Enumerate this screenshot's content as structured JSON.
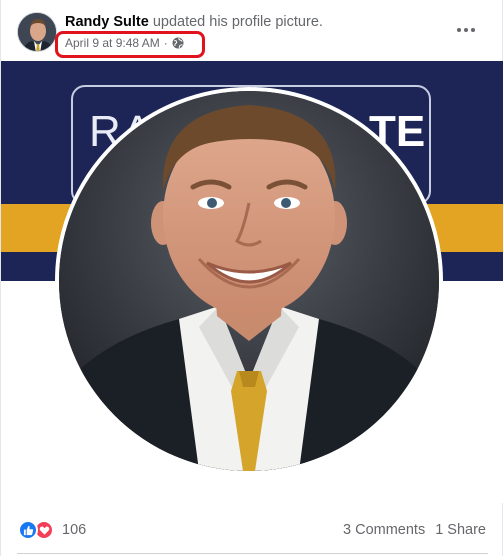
{
  "post": {
    "author": "Randy Sulte",
    "action": "updated his profile picture.",
    "timestamp": "April 9 at 9:48 AM",
    "separator": "·",
    "privacy_icon": "globe-icon",
    "more_icon": "more-options-icon"
  },
  "cover": {
    "text_left": "RA",
    "text_right": "TE",
    "colors": {
      "navy": "#1c2556",
      "gold": "#e3a323"
    }
  },
  "footer": {
    "reaction_icons": [
      "like-icon",
      "love-icon"
    ],
    "reaction_count": "106",
    "comments": "3 Comments",
    "shares": "1 Share"
  },
  "colors": {
    "highlight": "#e0131d",
    "like": "#1877f2",
    "love": "#f33e58"
  }
}
